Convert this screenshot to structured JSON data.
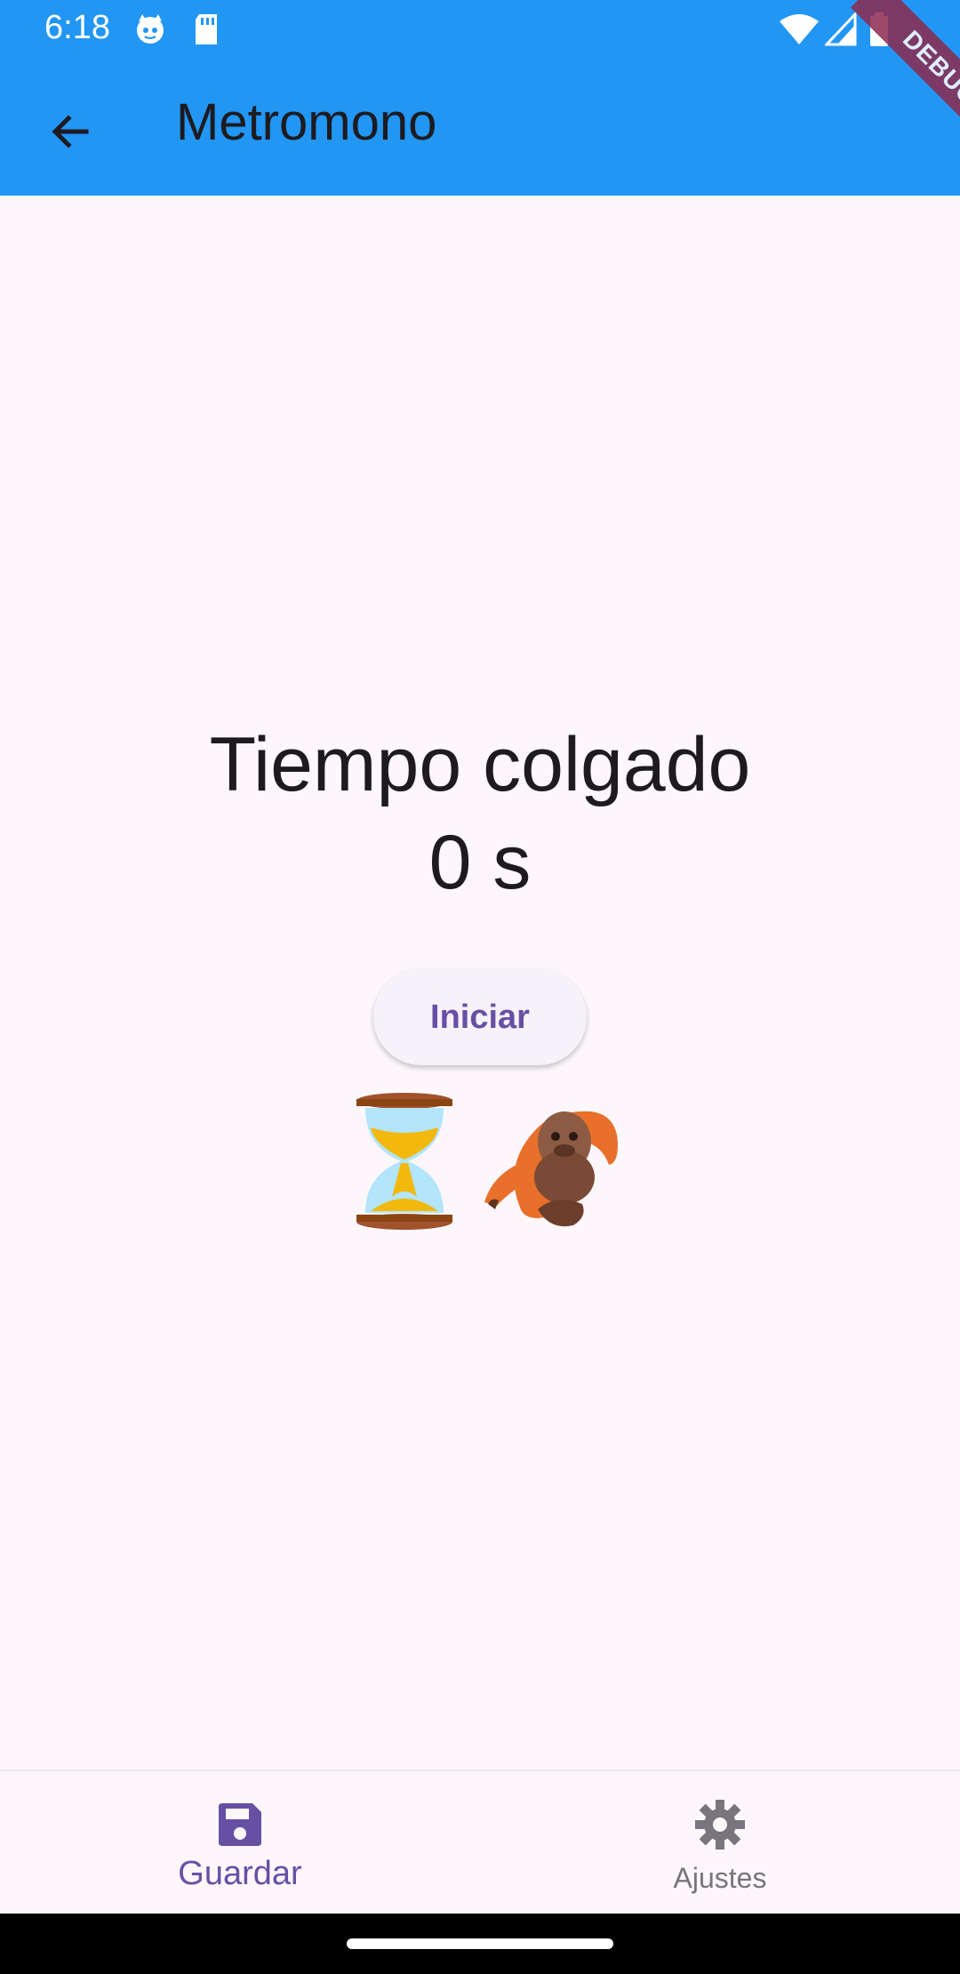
{
  "status_bar": {
    "time": "6:18",
    "icons": [
      "cat-face-icon",
      "sd-card-icon",
      "wifi-icon",
      "signal-icon",
      "battery-icon"
    ]
  },
  "app_bar": {
    "title": "Metromono",
    "back_icon": "arrow-back-icon",
    "background_color": "#2196f3"
  },
  "debug_banner": {
    "label": "DEBUG"
  },
  "timer": {
    "label": "Tiempo colgado",
    "value": "0 s"
  },
  "actions": {
    "start_label": "Iniciar"
  },
  "illustration": {
    "icons": [
      "hourglass-icon",
      "orangutan-icon"
    ]
  },
  "bottom_nav": {
    "items": [
      {
        "label": "Guardar",
        "icon": "save-icon",
        "active": true
      },
      {
        "label": "Ajustes",
        "icon": "settings-icon",
        "active": false
      }
    ]
  },
  "colors": {
    "accent": "#6750a4",
    "background": "#fdf7fc",
    "inactive": "#79747e"
  }
}
